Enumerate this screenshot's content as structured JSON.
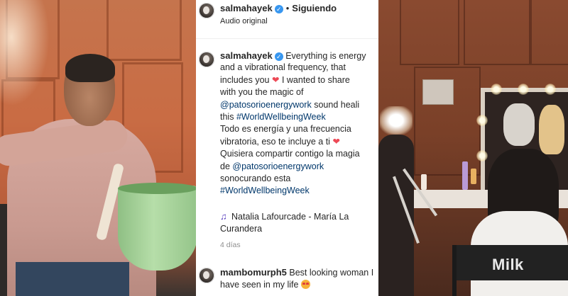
{
  "post": {
    "username": "salmahayek",
    "follow_status": "Siguiendo",
    "separator": "•",
    "audio_label": "Audio original",
    "verified_icon": "verified-check-icon",
    "caption_lines": [
      "Everything is energy",
      "and a vibrational frequency, that",
      "includes you",
      "I wanted to share",
      "with you the magic of",
      "@patosorioenergywork",
      "sound heali",
      "this",
      "#WorldWellbeingWeek",
      "Todo es energía y una frecuencia",
      "vibratoria, eso te incluye a ti",
      "Quisiera compartir contigo la magia",
      "de",
      "@patosorioenergywork",
      "sonocurando esta",
      "#WorldWellbeingWeek"
    ],
    "heart_glyph": "❤",
    "song": "Natalia Lafourcade - María La Curandera",
    "time_ago": "4 días"
  },
  "comment": {
    "username": "mambomurph5",
    "text": "Best looking woman I have seen in my life"
  },
  "right_photo": {
    "chair_label": "Milk"
  },
  "colors": {
    "link": "#00376b",
    "verified": "#3897f0",
    "heart": "#ed4956"
  }
}
